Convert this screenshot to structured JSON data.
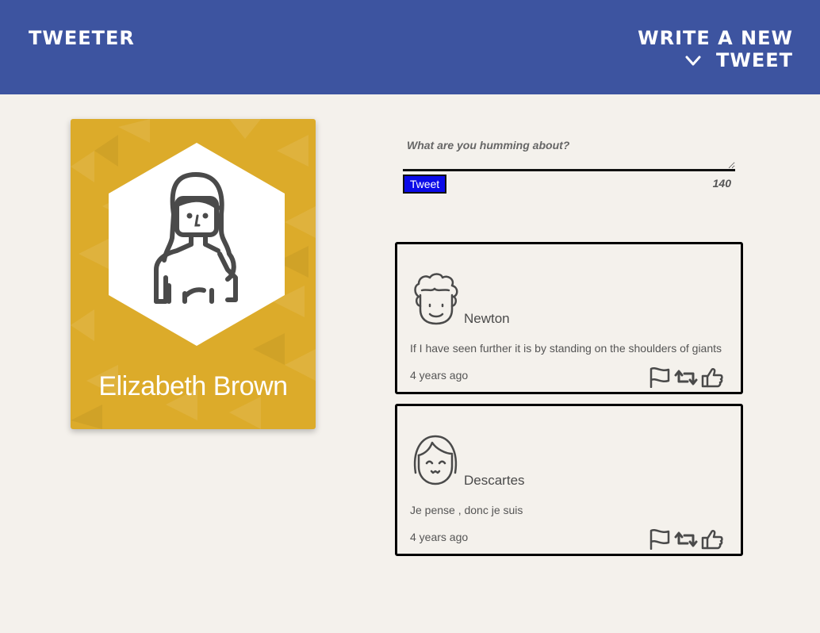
{
  "navbar": {
    "brand": "TWEETER",
    "compose_label": "WRITE A NEW TWEET",
    "compose_icon": "chevron-down-icon"
  },
  "profile": {
    "name": "Elizabeth Brown",
    "avatar_icon": "woman-long-hair-avatar-icon",
    "card_color": "#dcab2a"
  },
  "composer": {
    "placeholder": "What are you humming about?",
    "button_label": "Tweet",
    "counter": "140",
    "button_color": "#0b0be8"
  },
  "tweets": [
    {
      "author": "Newton",
      "avatar_icon": "curly-hair-avatar-icon",
      "text": "If I have seen further it is by standing on the shoulders of giants",
      "time": "4 years ago",
      "actions": [
        "flag-icon",
        "retweet-icon",
        "like-icon"
      ]
    },
    {
      "author": "Descartes",
      "avatar_icon": "bob-hair-avatar-icon",
      "text": "Je pense , donc je suis",
      "time": "4 years ago",
      "actions": [
        "flag-icon",
        "retweet-icon",
        "like-icon"
      ]
    }
  ],
  "colors": {
    "navbar": "#3d54a0",
    "page_background": "#f4f1ec"
  }
}
